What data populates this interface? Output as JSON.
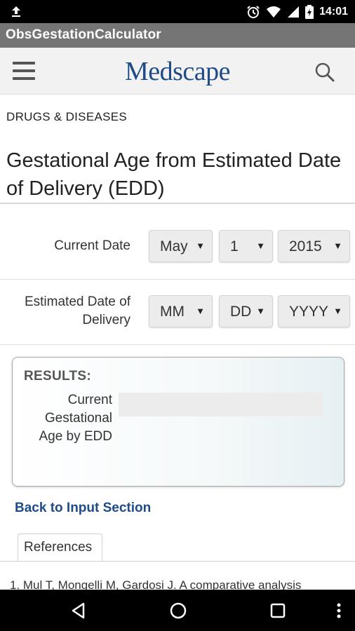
{
  "status_bar": {
    "time": "14:01",
    "icons": [
      "upload-icon",
      "alarm-icon",
      "wifi-icon",
      "signal-icon",
      "battery-icon"
    ]
  },
  "app_bar": {
    "title": "ObsGestationCalculator"
  },
  "header": {
    "logo_text": "Medscape",
    "menu_icon": "hamburger-menu-icon",
    "search_icon": "search-icon",
    "brand_color": "#1f4c87"
  },
  "page": {
    "section_label": "DRUGS & DISEASES",
    "title": "Gestational Age from Estimated Date of Delivery (EDD)"
  },
  "form": {
    "current_date": {
      "label": "Current Date",
      "month": "May",
      "day": "1",
      "year": "2015"
    },
    "edd": {
      "label": "Estimated Date of Delivery",
      "month": "MM",
      "day": "DD",
      "year": "YYYY"
    },
    "dropdown_arrow": "▼"
  },
  "results": {
    "heading": "RESULTS:",
    "label": "Current Gestational Age by EDD",
    "value": ""
  },
  "links": {
    "back": "Back to Input Section"
  },
  "references": {
    "tab_label": "References",
    "items": [
      "1. Mul T, Mongelli M, Gardosi J. A comparative analysis"
    ]
  },
  "nav_bar": {
    "buttons": [
      "back-icon",
      "home-icon",
      "recents-icon",
      "more-icon"
    ]
  }
}
